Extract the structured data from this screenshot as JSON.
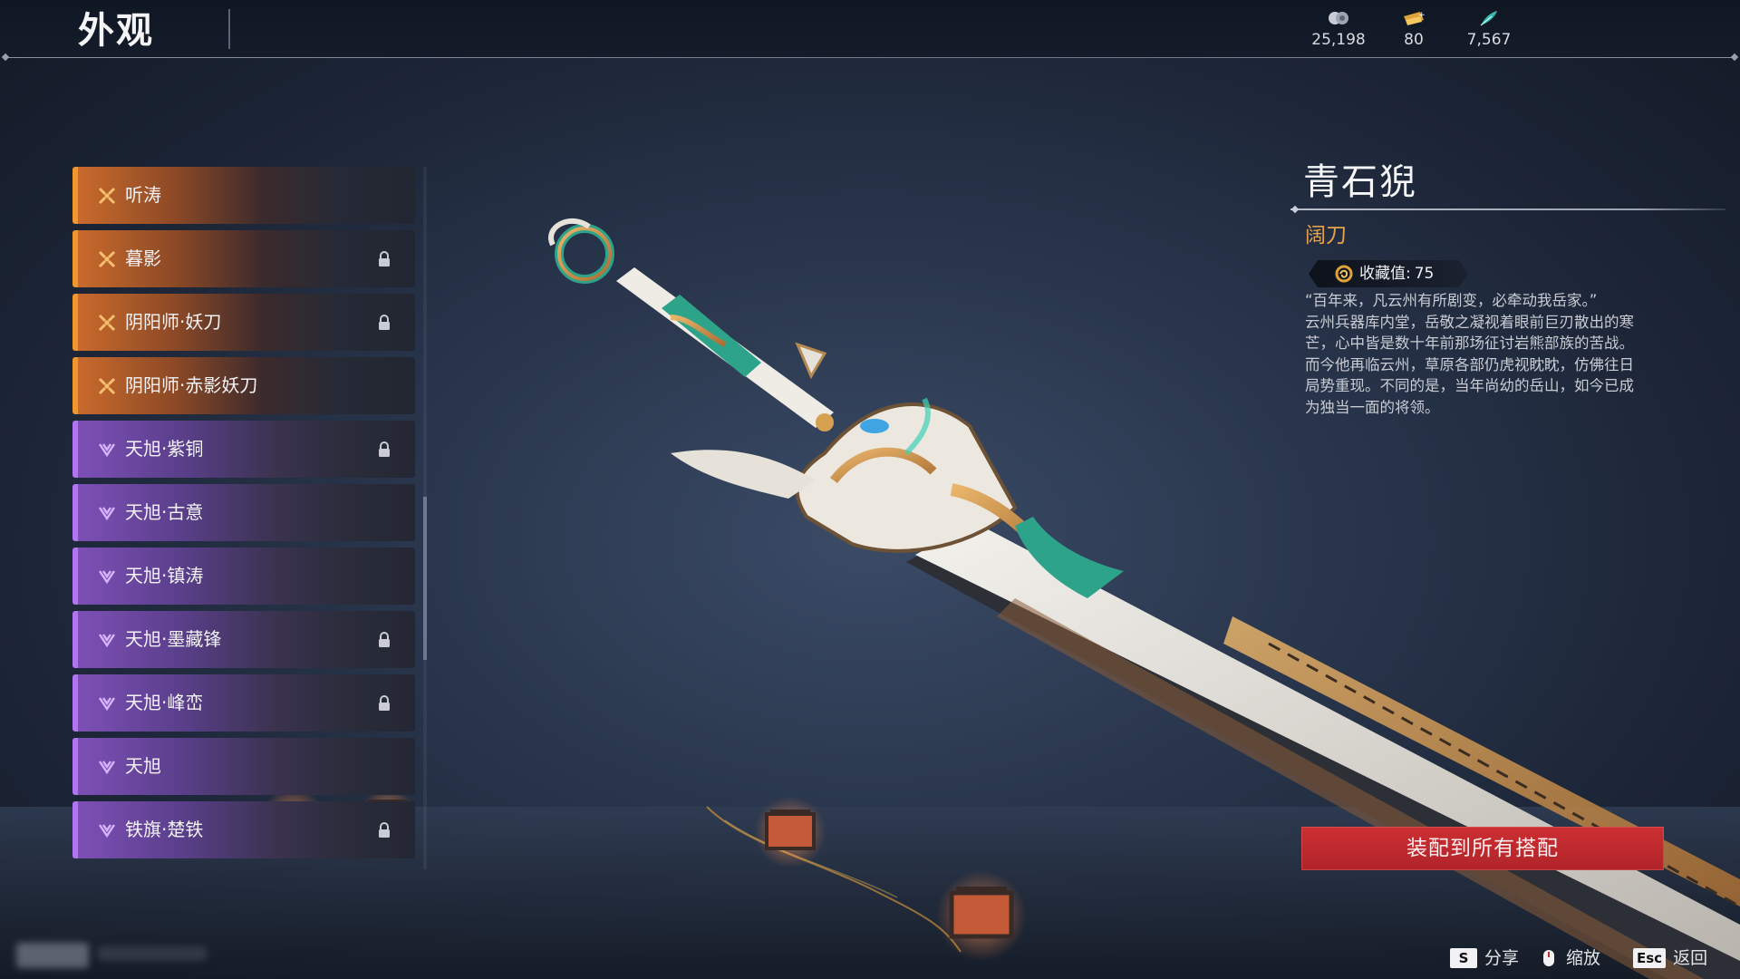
{
  "header": {
    "title": "外观",
    "currencies": [
      {
        "icon": "coin-stack-icon",
        "value": "25,198"
      },
      {
        "icon": "ticket-icon",
        "value": "80"
      },
      {
        "icon": "feather-icon",
        "value": "7,567"
      }
    ]
  },
  "skin_list": {
    "items": [
      {
        "label": "听涛",
        "rarity": "orange",
        "locked": false
      },
      {
        "label": "暮影",
        "rarity": "orange",
        "locked": true
      },
      {
        "label": "阴阳师·妖刀",
        "rarity": "orange",
        "locked": true
      },
      {
        "label": "阴阳师·赤影妖刀",
        "rarity": "orange",
        "locked": false
      },
      {
        "label": "天旭·紫铜",
        "rarity": "purple",
        "locked": true
      },
      {
        "label": "天旭·古意",
        "rarity": "purple",
        "locked": false
      },
      {
        "label": "天旭·镇涛",
        "rarity": "purple",
        "locked": false
      },
      {
        "label": "天旭·墨藏锋",
        "rarity": "purple",
        "locked": true
      },
      {
        "label": "天旭·峰峦",
        "rarity": "purple",
        "locked": true
      },
      {
        "label": "天旭",
        "rarity": "purple",
        "locked": false
      },
      {
        "label": "铁旗·楚铁",
        "rarity": "purple",
        "locked": true
      }
    ]
  },
  "detail": {
    "name": "青石猊",
    "type": "阔刀",
    "collection_label": "收藏值:",
    "collection_value": "75",
    "description": "“百年来，凡云州有所剧变，必牵动我岳家。”\n云州兵器库内堂，岳敬之凝视着眼前巨刃散出的寒\n芒，心中皆是数十年前那场征讨岩熊部族的苦战。\n而今他再临云州，草原各部仍虎视眈眈，仿佛往日\n局势重现。不同的是，当年尚幼的岳山，如今已成\n为独当一面的将领。"
  },
  "actions": {
    "equip_all": "装配到所有搭配"
  },
  "hints": [
    {
      "key": "S",
      "label": "分享"
    },
    {
      "key": "",
      "label": "缩放"
    },
    {
      "key": "Esc",
      "label": "返回"
    }
  ],
  "colors": {
    "orange_rarity": "#f0962f",
    "purple_rarity": "#b175f2",
    "accent_red": "#c42a2f",
    "type_gold": "#e5a24d"
  }
}
